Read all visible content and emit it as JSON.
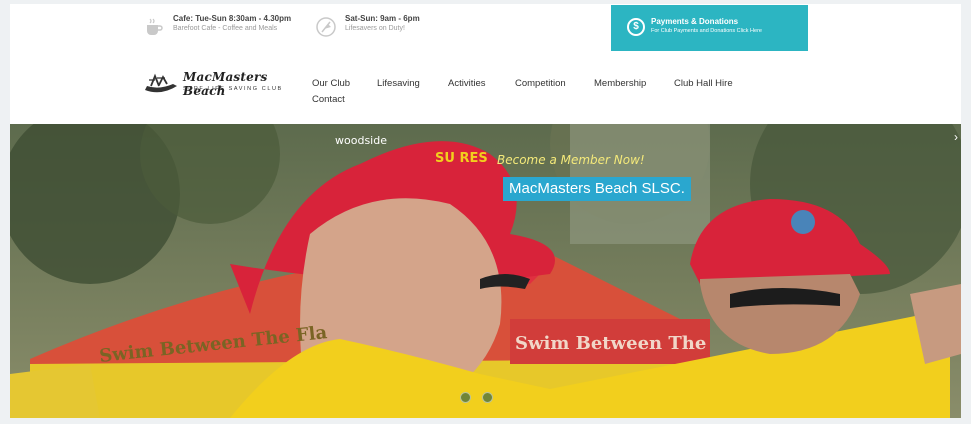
{
  "topbar": {
    "cafe": {
      "title": "Cafe: Tue-Sun 8:30am - 4.30pm",
      "subtitle": "Barefoot Cafe - Coffee and Meals"
    },
    "weekend": {
      "title": "Sat-Sun: 9am - 6pm",
      "subtitle": "Lifesavers on Duty!"
    },
    "payments": {
      "title": "Payments & Donations",
      "subtitle": "For Club Payments and Donations Click Here"
    }
  },
  "logo": {
    "name": "MacMasters Beach",
    "tagline": "SURF LIFE SAVING CLUB"
  },
  "nav": {
    "items": [
      "Our Club",
      "Lifesaving",
      "Activities",
      "Competition",
      "Membership",
      "Club Hall Hire",
      "Contact"
    ]
  },
  "hero": {
    "tagline": "Become a Member Now!",
    "headline": "MacMasters Beach SLSC.",
    "hat_brand": "woodside",
    "hat_text": "SU RES",
    "banner_text": "Swim Between The Fla",
    "banner_text_2": "Swim Between The",
    "next_arrow": "›",
    "slide_count": 2
  },
  "colors": {
    "accent": "#2cb5c2",
    "headline_bg": "#2aa7cf",
    "hat_red": "#d8233a",
    "uniform_yellow": "#f2cf1d"
  }
}
